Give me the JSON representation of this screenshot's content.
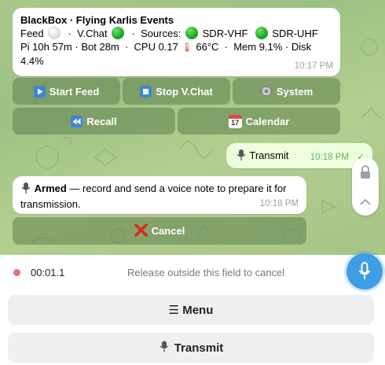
{
  "messages": {
    "status": {
      "title": "BlackBox · Flying Karlis Events",
      "feed_label": "Feed",
      "vchat_label": "V.Chat",
      "sources_label": "Sources:",
      "source1": "SDR-VHF",
      "source2": "SDR-UHF",
      "sep": "·",
      "line3": "Pi 10h 57m · Bot 28m",
      "cpu": "CPU 0.17",
      "temp": "66°C",
      "mem": "Mem 9.1% · Disk",
      "disk": "4.4%",
      "time": "10:17 PM"
    },
    "outgoing": {
      "text": "Transmit",
      "time": "10:18 PM"
    },
    "armed": {
      "bold": "Armed",
      "text": " — record and send a voice note to prepare it for transmission.",
      "time": "10:18 PM"
    }
  },
  "inline_keyboard": {
    "start_feed": "Start Feed",
    "stop_vchat": "Stop V.Chat",
    "system": "System",
    "recall": "Recall",
    "calendar": "Calendar",
    "cancel": "Cancel"
  },
  "recording": {
    "timer": "00:01.1",
    "hint": "Release outside this field to cancel",
    "dot_color": "#e57373",
    "mic_color": "#3f9de6"
  },
  "reply_keyboard": {
    "menu": "☰ Menu",
    "transmit": "Transmit"
  },
  "icons": {
    "calendar_glyph": "17"
  }
}
